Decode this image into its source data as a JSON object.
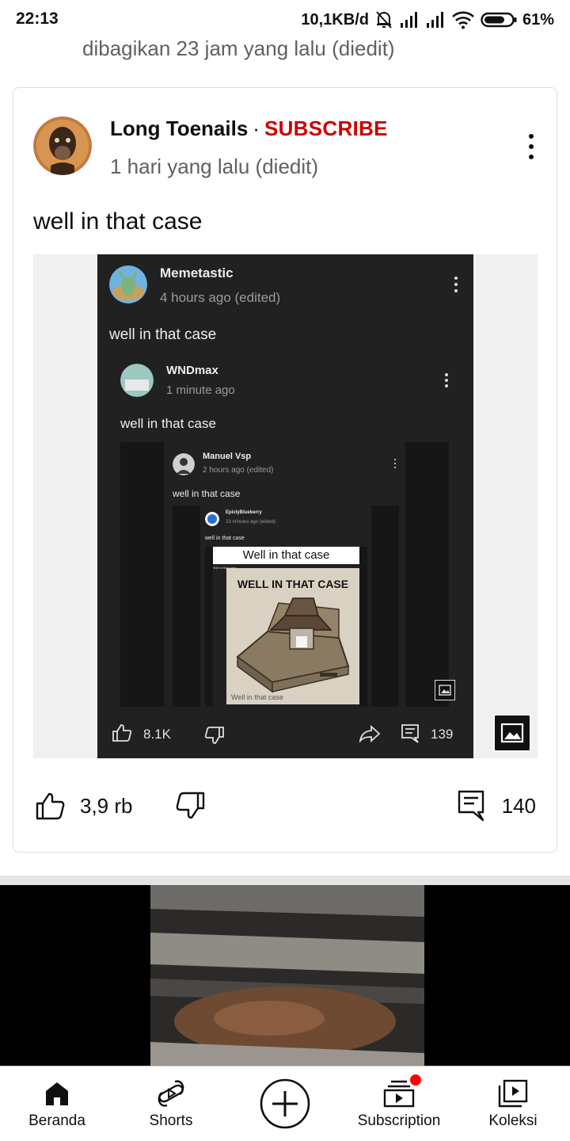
{
  "status_bar": {
    "time": "22:13",
    "net_speed": "10,1KB/d",
    "battery": "61%",
    "icons": [
      "mute-bell-icon",
      "signal-icon",
      "signal-icon",
      "wifi-icon",
      "battery-icon"
    ]
  },
  "shared_line": "dibagikan 23 jam yang lalu (diedit)",
  "post": {
    "author": "Long Toenails",
    "separator": "·",
    "subscribe": "SUBSCRIBE",
    "time": "1 hari yang lalu (diedit)",
    "text": "well in that case",
    "likes": "3,9 rb",
    "comments": "140"
  },
  "embedded": {
    "level1": {
      "name": "Memetastic",
      "time": "4 hours ago (edited)",
      "text": "well in that case"
    },
    "level2": {
      "name": "WNDmax",
      "time": "1 minute ago",
      "text": "well in that case"
    },
    "level3": {
      "name": "Manuel Vsp",
      "time": "2 hours ago (edited)",
      "text": "well in that case"
    },
    "level4": {
      "name": "EpiclyBlueberry",
      "time": "23 minutes ago (edited)",
      "text": "well in that case"
    },
    "level5": {
      "title": "Well in that case",
      "text": "Well in that case"
    },
    "meme": {
      "title": "WELL IN THAT CASE",
      "caption": "Well in that case"
    },
    "likes": "8.1K",
    "comments": "139"
  },
  "nav": [
    {
      "label": "Beranda",
      "icon": "home-icon"
    },
    {
      "label": "Shorts",
      "icon": "shorts-icon"
    },
    {
      "label": "",
      "icon": "create-icon"
    },
    {
      "label": "Subscription",
      "icon": "subscriptions-icon"
    },
    {
      "label": "Koleksi",
      "icon": "library-icon"
    }
  ],
  "colors": {
    "accent": "#cc0000",
    "notification_dot": "#ff0000",
    "embedded_bg": "#212121"
  }
}
